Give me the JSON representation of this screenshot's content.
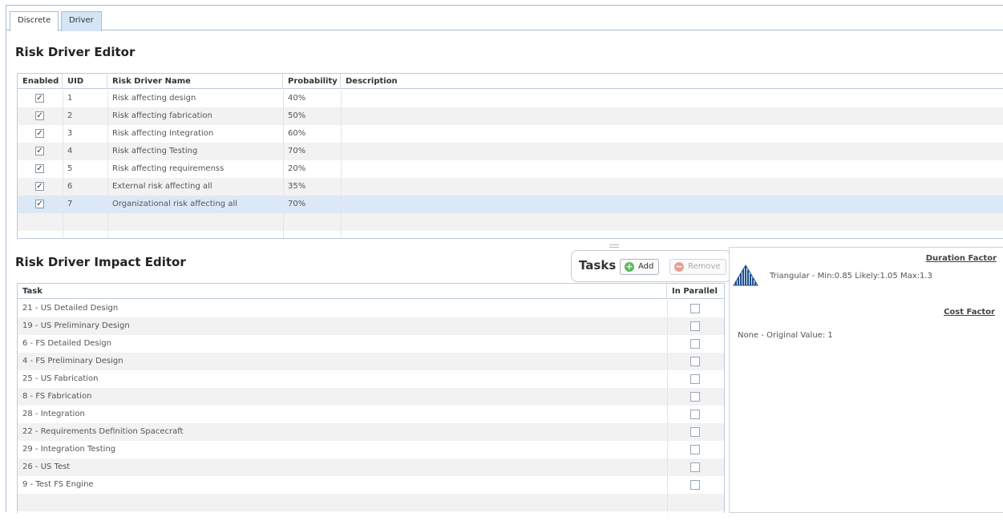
{
  "tabs": [
    {
      "label": "Discrete",
      "active": false
    },
    {
      "label": "Driver",
      "active": true
    }
  ],
  "risk_driver_editor": {
    "title": "Risk Driver Editor",
    "columns": [
      "Enabled",
      "UID",
      "Risk Driver Name",
      "Probability",
      "Description"
    ],
    "rows": [
      {
        "enabled": true,
        "uid": "1",
        "name": "Risk affecting design",
        "probability": "40%",
        "description": ""
      },
      {
        "enabled": true,
        "uid": "2",
        "name": "Risk affecting fabrication",
        "probability": "50%",
        "description": ""
      },
      {
        "enabled": true,
        "uid": "3",
        "name": "Risk affecting Integration",
        "probability": "60%",
        "description": ""
      },
      {
        "enabled": true,
        "uid": "4",
        "name": "Risk affecting Testing",
        "probability": "70%",
        "description": ""
      },
      {
        "enabled": true,
        "uid": "5",
        "name": "Risk affecting requiremenss",
        "probability": "20%",
        "description": ""
      },
      {
        "enabled": true,
        "uid": "6",
        "name": "External risk affecting all",
        "probability": "35%",
        "description": ""
      },
      {
        "enabled": true,
        "uid": "7",
        "name": "Organizational risk affecting all",
        "probability": "70%",
        "description": "",
        "selected": true
      }
    ]
  },
  "impact_editor": {
    "title": "Risk Driver Impact Editor",
    "tasks_label": "Tasks",
    "add_label": "Add",
    "remove_label": "Remove",
    "columns": [
      "Task",
      "In Parallel"
    ],
    "rows": [
      {
        "task": "21 - US  Detailed Design",
        "in_parallel": false
      },
      {
        "task": "19 - US Preliminary Design",
        "in_parallel": false
      },
      {
        "task": "6 - FS Detailed Design",
        "in_parallel": false
      },
      {
        "task": "4 - FS Preliminary Design",
        "in_parallel": false
      },
      {
        "task": "25 - US Fabrication",
        "in_parallel": false
      },
      {
        "task": "8 - FS Fabrication",
        "in_parallel": false
      },
      {
        "task": "28 - Integration",
        "in_parallel": false
      },
      {
        "task": "22 - Requirements Definition Spacecraft",
        "in_parallel": false
      },
      {
        "task": "29 - Integration Testing",
        "in_parallel": false
      },
      {
        "task": "26 - US Test",
        "in_parallel": false
      },
      {
        "task": "9 - Test FS Engine",
        "in_parallel": false
      }
    ]
  },
  "factors": {
    "duration_label": "Duration Factor",
    "duration_text": "Triangular - Min:0.85 Likely:1.05 Max:1.3",
    "cost_label": "Cost Factor",
    "cost_text": "None - Original Value: 1"
  },
  "colors": {
    "accent_border": "#a9bcd6",
    "active_tab": "#d6e5f6",
    "selected_row": "#dde8f7",
    "add_icon": "#5cb85c",
    "remove_icon": "#e8a090"
  }
}
